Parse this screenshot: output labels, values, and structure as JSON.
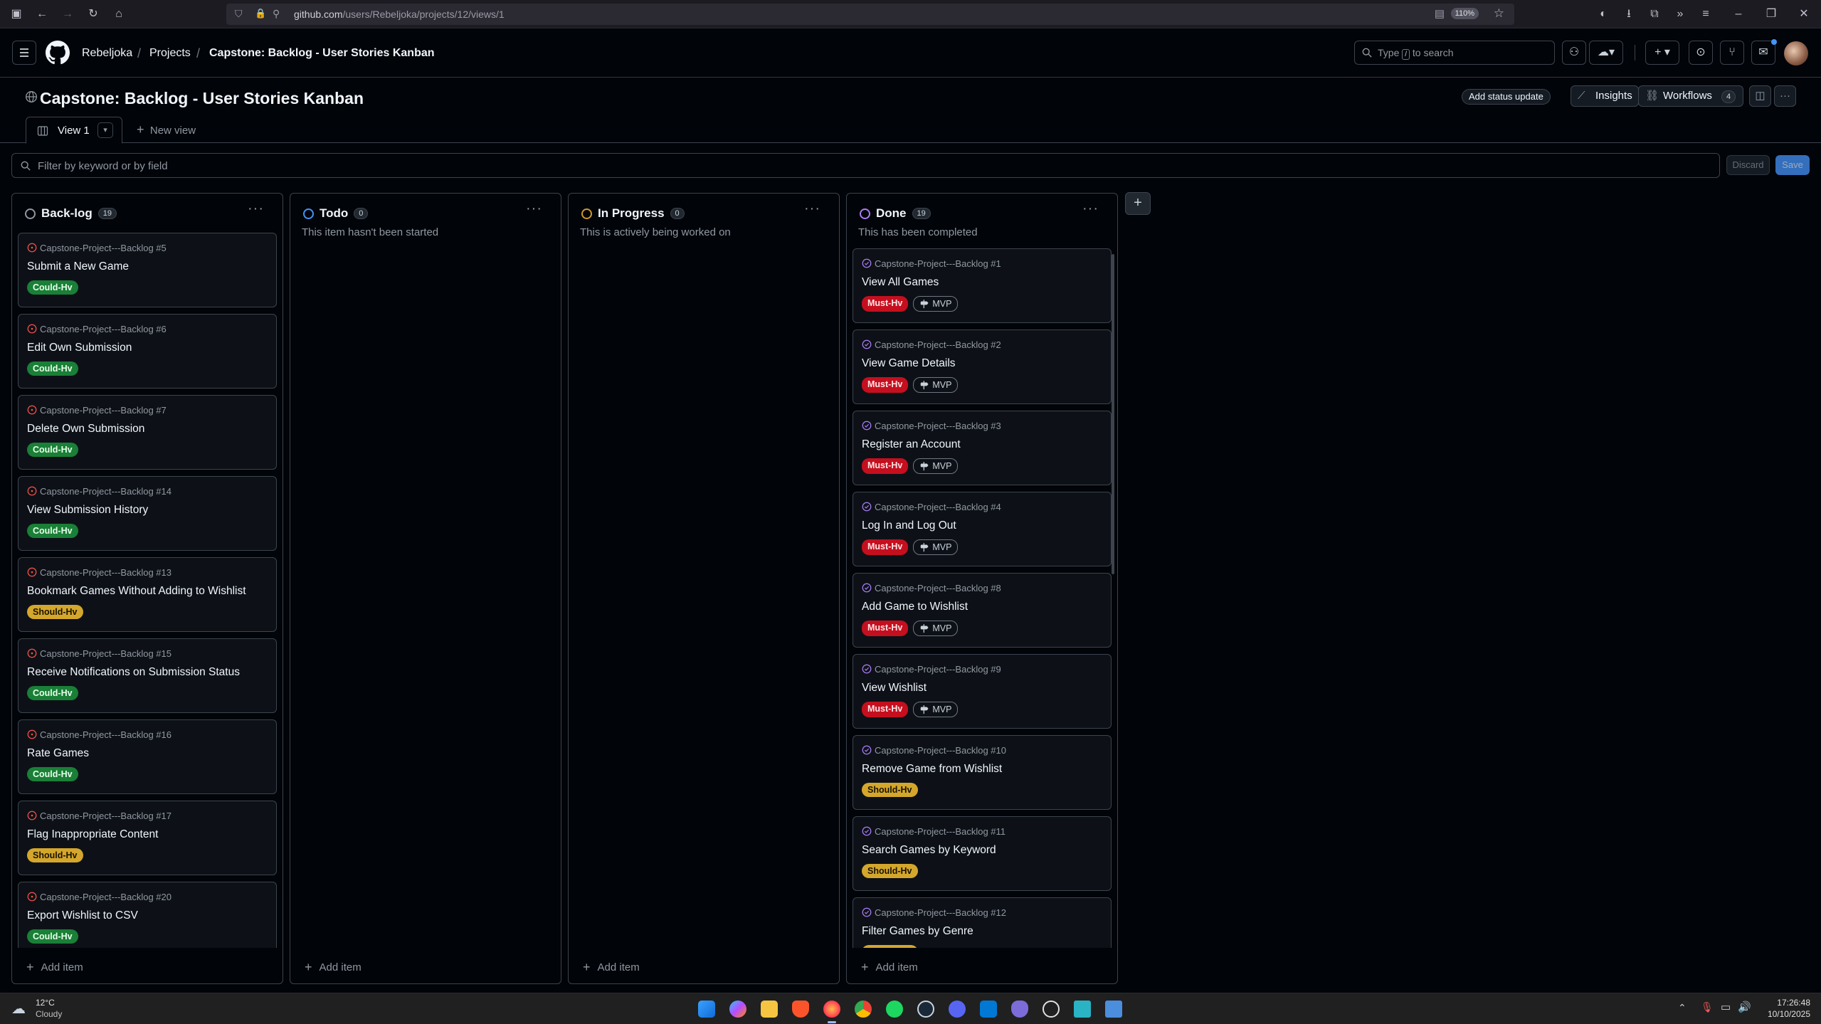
{
  "browser": {
    "url_host": "github.com",
    "url_path": "/users/Rebeljoka/projects/12/views/1",
    "zoom": "110%"
  },
  "header": {
    "breadcrumbs": [
      "Rebeljoka",
      "Projects",
      "Capstone: Backlog - User Stories Kanban"
    ],
    "search_placeholder_pre": "Type",
    "search_key": "/",
    "search_placeholder_post": "to search"
  },
  "project": {
    "title": "Capstone: Backlog - User Stories Kanban",
    "add_status_update": "Add status update",
    "insights": "Insights",
    "workflows": "Workflows",
    "workflows_count": "4",
    "tabs": [
      {
        "label": "View 1"
      },
      {
        "label": "New view"
      }
    ],
    "filter_placeholder": "Filter by keyword or by field",
    "discard": "Discard",
    "save": "Save"
  },
  "board": {
    "add_item": "Add item",
    "columns": [
      {
        "title": "Back-log",
        "count": "19",
        "description": "",
        "status_color": "#9198a1",
        "cards": [
          {
            "repo": "Capstone-Project---Backlog #5",
            "title": "Submit a New Game",
            "labels": [
              {
                "text": "Could-Hv",
                "kind": "could"
              }
            ]
          },
          {
            "repo": "Capstone-Project---Backlog #6",
            "title": "Edit Own Submission",
            "labels": [
              {
                "text": "Could-Hv",
                "kind": "could"
              }
            ]
          },
          {
            "repo": "Capstone-Project---Backlog #7",
            "title": "Delete Own Submission",
            "labels": [
              {
                "text": "Could-Hv",
                "kind": "could"
              }
            ]
          },
          {
            "repo": "Capstone-Project---Backlog #14",
            "title": "View Submission History",
            "labels": [
              {
                "text": "Could-Hv",
                "kind": "could"
              }
            ]
          },
          {
            "repo": "Capstone-Project---Backlog #13",
            "title": "Bookmark Games Without Adding to Wishlist",
            "labels": [
              {
                "text": "Should-Hv",
                "kind": "should"
              }
            ]
          },
          {
            "repo": "Capstone-Project---Backlog #15",
            "title": "Receive Notifications on Submission Status",
            "labels": [
              {
                "text": "Could-Hv",
                "kind": "could"
              }
            ]
          },
          {
            "repo": "Capstone-Project---Backlog #16",
            "title": "Rate Games",
            "labels": [
              {
                "text": "Could-Hv",
                "kind": "could"
              }
            ]
          },
          {
            "repo": "Capstone-Project---Backlog #17",
            "title": "Flag Inappropriate Content",
            "labels": [
              {
                "text": "Should-Hv",
                "kind": "should"
              }
            ]
          },
          {
            "repo": "Capstone-Project---Backlog #20",
            "title": "Export Wishlist to CSV",
            "labels": [
              {
                "text": "Could-Hv",
                "kind": "could"
              }
            ]
          }
        ]
      },
      {
        "title": "Todo",
        "count": "0",
        "description": "This item hasn't been started",
        "status_color": "#4493f8",
        "cards": []
      },
      {
        "title": "In Progress",
        "count": "0",
        "description": "This is actively being worked on",
        "status_color": "#d29922",
        "cards": []
      },
      {
        "title": "Done",
        "count": "19",
        "description": "This has been completed",
        "status_color": "#ab7df8",
        "cards": [
          {
            "repo": "Capstone-Project---Backlog #1",
            "title": "View All Games",
            "labels": [
              {
                "text": "Must-Hv",
                "kind": "must"
              },
              {
                "text": "MVP",
                "kind": "ms"
              }
            ]
          },
          {
            "repo": "Capstone-Project---Backlog #2",
            "title": "View Game Details",
            "labels": [
              {
                "text": "Must-Hv",
                "kind": "must"
              },
              {
                "text": "MVP",
                "kind": "ms"
              }
            ]
          },
          {
            "repo": "Capstone-Project---Backlog #3",
            "title": "Register an Account",
            "labels": [
              {
                "text": "Must-Hv",
                "kind": "must"
              },
              {
                "text": "MVP",
                "kind": "ms"
              }
            ]
          },
          {
            "repo": "Capstone-Project---Backlog #4",
            "title": "Log In and Log Out",
            "labels": [
              {
                "text": "Must-Hv",
                "kind": "must"
              },
              {
                "text": "MVP",
                "kind": "ms"
              }
            ]
          },
          {
            "repo": "Capstone-Project---Backlog #8",
            "title": "Add Game to Wishlist",
            "labels": [
              {
                "text": "Must-Hv",
                "kind": "must"
              },
              {
                "text": "MVP",
                "kind": "ms"
              }
            ]
          },
          {
            "repo": "Capstone-Project---Backlog #9",
            "title": "View Wishlist",
            "labels": [
              {
                "text": "Must-Hv",
                "kind": "must"
              },
              {
                "text": "MVP",
                "kind": "ms"
              }
            ]
          },
          {
            "repo": "Capstone-Project---Backlog #10",
            "title": "Remove Game from Wishlist",
            "labels": [
              {
                "text": "Should-Hv",
                "kind": "should"
              }
            ]
          },
          {
            "repo": "Capstone-Project---Backlog #11",
            "title": "Search Games by Keyword",
            "labels": [
              {
                "text": "Should-Hv",
                "kind": "should"
              }
            ]
          },
          {
            "repo": "Capstone-Project---Backlog #12",
            "title": "Filter Games by Genre",
            "labels": [
              {
                "text": "Should-Hv",
                "kind": "should"
              }
            ]
          }
        ]
      }
    ]
  },
  "taskbar": {
    "weather_temp": "12°C",
    "weather_desc": "Cloudy",
    "time": "17:26:48",
    "date": "10/10/2025"
  }
}
